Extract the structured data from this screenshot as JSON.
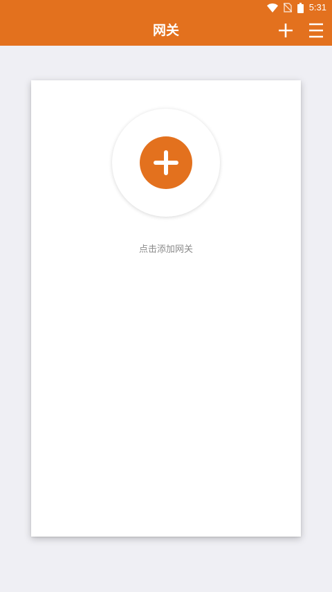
{
  "status_bar": {
    "time": "5:31",
    "icons": [
      "wifi-icon",
      "no-sim-icon",
      "battery-icon"
    ]
  },
  "header": {
    "title": "网关",
    "actions": [
      "plus-icon",
      "menu-icon"
    ]
  },
  "main": {
    "add_gateway_label": "点击添加网关"
  },
  "colors": {
    "accent": "#e3711e",
    "background": "#efeff4",
    "card": "#ffffff",
    "hint_text": "#8a8a8a"
  }
}
